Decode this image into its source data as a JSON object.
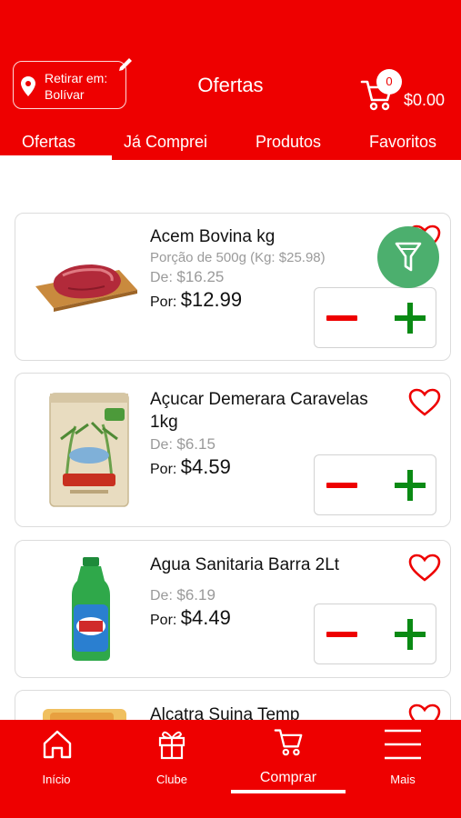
{
  "header": {
    "pickup_line1": "Retirar em:",
    "pickup_line2": "Bolívar",
    "title": "Ofertas",
    "cart_count": "0",
    "cart_total": "$0.00"
  },
  "tabs": [
    "Ofertas",
    "Já Comprei",
    "Produtos",
    "Favoritos"
  ],
  "products": [
    {
      "name": "Acem Bovina kg",
      "portion": "Porção de 500g (Kg: $25.98)",
      "de_label": "De:",
      "de_price": "$16.25",
      "por_label": "Por:",
      "por_price": "$12.99"
    },
    {
      "name_line1": "Açucar Demerara Caravelas",
      "name_line2": "1kg",
      "de_label": "De:",
      "de_price": "$6.15",
      "por_label": "Por:",
      "por_price": "$4.59"
    },
    {
      "name": "Agua Sanitaria Barra 2Lt",
      "de_label": "De:",
      "de_price": "$6.19",
      "por_label": "Por:",
      "por_price": "$4.49"
    },
    {
      "name": "Alcatra Suina Temp"
    }
  ],
  "bottom_nav": [
    "Início",
    "Clube",
    "Comprar",
    "Mais"
  ],
  "colors": {
    "primary": "#ee0000",
    "plus": "#0a8a14",
    "filter": "#4caf6e"
  },
  "icons": [
    "location-pin-icon",
    "pencil-icon",
    "cart-icon",
    "heart-icon",
    "filter-icon",
    "home-icon",
    "gift-icon",
    "menu-icon"
  ]
}
